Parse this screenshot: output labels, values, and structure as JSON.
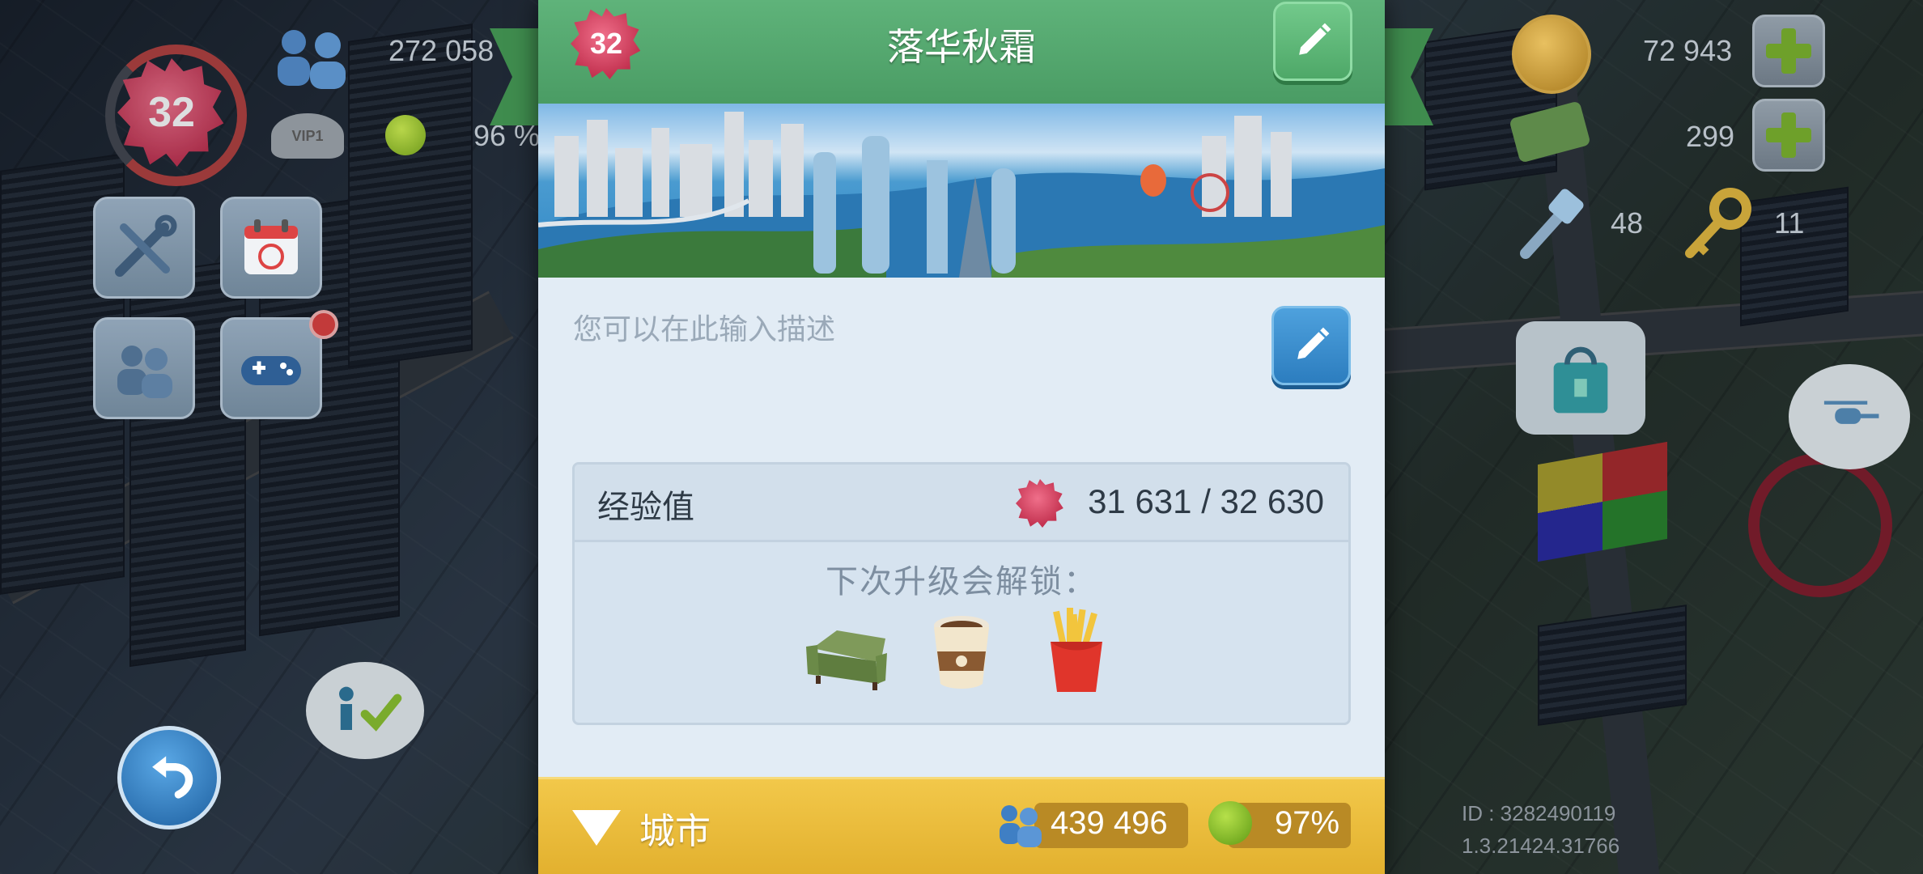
{
  "hud": {
    "level": "32",
    "population": "272 058",
    "happiness": "96 %",
    "vip": "VIP1",
    "simoleons": "72 943",
    "simcash": "299",
    "golden_keys_left": "48",
    "keys": "11",
    "id_label": "ID : 3282490119",
    "version": "1.3.21424.31766"
  },
  "dialog": {
    "level": "32",
    "title": "落华秋霜",
    "description_placeholder": "您可以在此输入描述",
    "xp": {
      "label": "经验值",
      "value": "31 631 / 32 630",
      "progress_fraction": 0.969
    },
    "unlock_title": "下次升级会解锁：",
    "unlock_items": [
      "sofa-icon",
      "coffee-cup-icon",
      "french-fries-icon"
    ],
    "footer": {
      "label": "城市",
      "population": "439 496",
      "happiness": "97%"
    }
  },
  "colors": {
    "header_green": "#4a9c64",
    "footer_yellow": "#e2b02e",
    "level_badge": "#c2314f",
    "edit_blue": "#2c7dbf"
  }
}
